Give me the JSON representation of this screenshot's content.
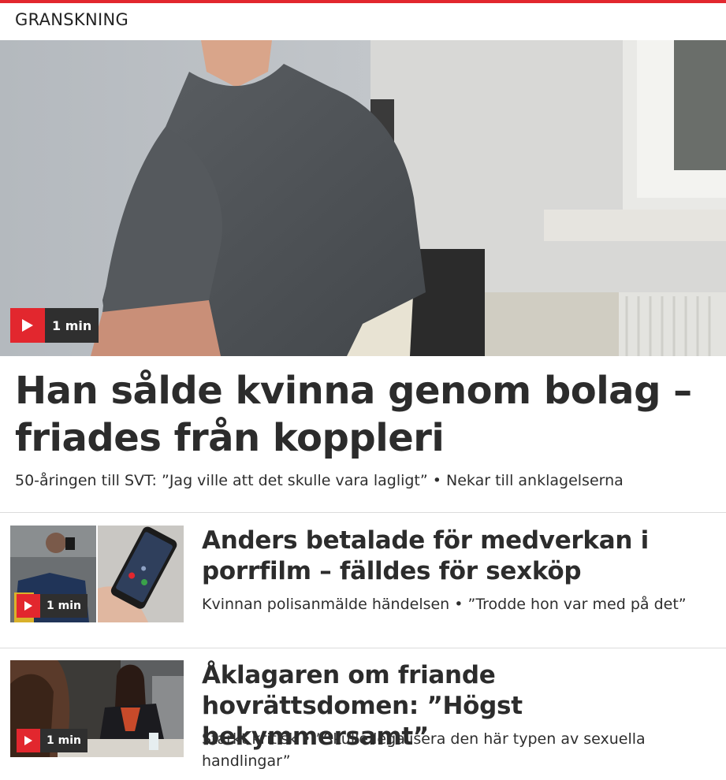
{
  "section": {
    "label": "GRANSKNING"
  },
  "colors": {
    "accent": "#e2272e",
    "badge_bg": "#2f2f2f"
  },
  "hero": {
    "duration": "1 min",
    "title": "Han sålde kvinna genom bolag – friades från koppleri",
    "subtitle": "50-åringen till SVT: ”Jag ville att det skulle vara lagligt” • Nekar till anklagelserna"
  },
  "articles": [
    {
      "duration": "1 min",
      "title": "Anders betalade för medverkan i porrfilm – fälldes för sexköp",
      "subtitle": "Kvinnan polisanmälde händelsen • ”Trodde hon var med på det”"
    },
    {
      "duration": "1 min",
      "title": "Åklagaren om friande hovrättsdomen: ”Högst bekymmersamt”",
      "subtitle": "Starkt kritisk • ”Skulle legalisera den här typen av sexuella handlingar”"
    }
  ]
}
